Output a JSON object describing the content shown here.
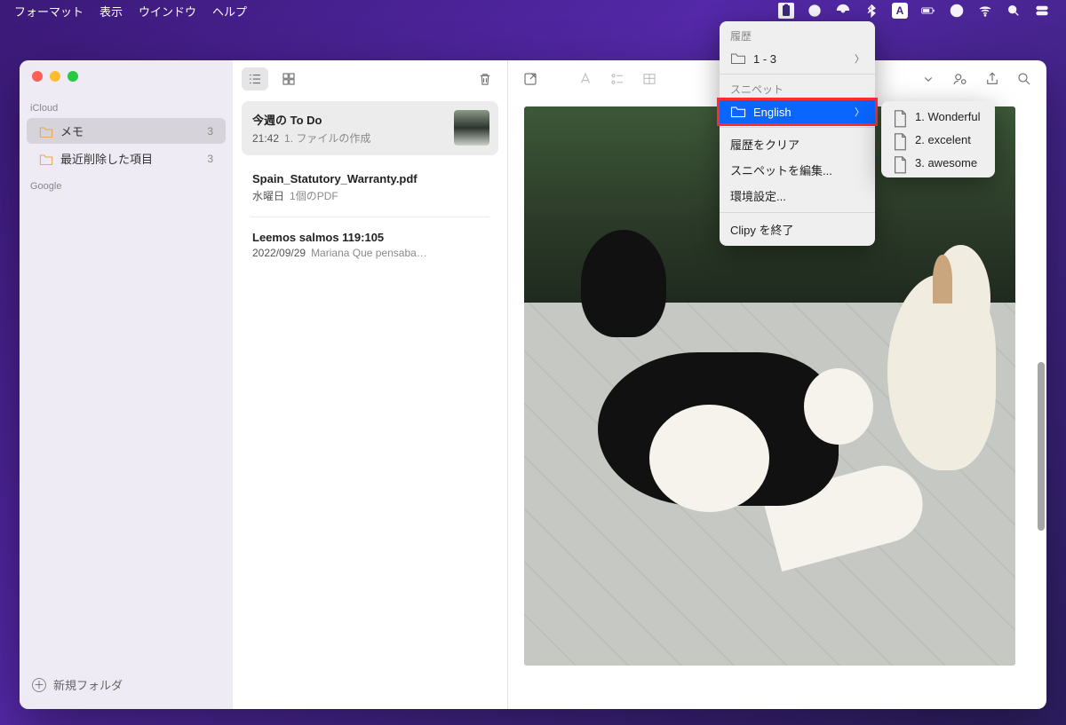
{
  "menubar": {
    "items": [
      "フォーマット",
      "表示",
      "ウインドウ",
      "ヘルプ"
    ],
    "input_indicator": "A"
  },
  "sidebar": {
    "sections": {
      "icloud": {
        "label": "iCloud",
        "items": [
          {
            "label": "メモ",
            "count": "3"
          },
          {
            "label": "最近削除した項目",
            "count": "3"
          }
        ]
      },
      "google": {
        "label": "Google"
      }
    },
    "footer": "新規フォルダ"
  },
  "notes": [
    {
      "title": "今週の To Do",
      "time": "21:42",
      "preview": "1. ファイルの作成"
    },
    {
      "title": "Spain_Statutory_Warranty.pdf",
      "time": "水曜日",
      "preview": "1個のPDF"
    },
    {
      "title": "Leemos salmos 119:105",
      "time": "2022/09/29",
      "preview": "Mariana Que pensaba…"
    }
  ],
  "clipy_menu": {
    "header": "履歴",
    "history_group": "1 - 3",
    "snippet_header": "スニペット",
    "english_folder": "English",
    "clear_history": "履歴をクリア",
    "edit_snippets": "スニペットを編集...",
    "preferences": "環境設定...",
    "quit": "Clipy を終了"
  },
  "submenu": {
    "items": [
      "1. Wonderful",
      "2. excelent",
      "3. awesome"
    ]
  }
}
